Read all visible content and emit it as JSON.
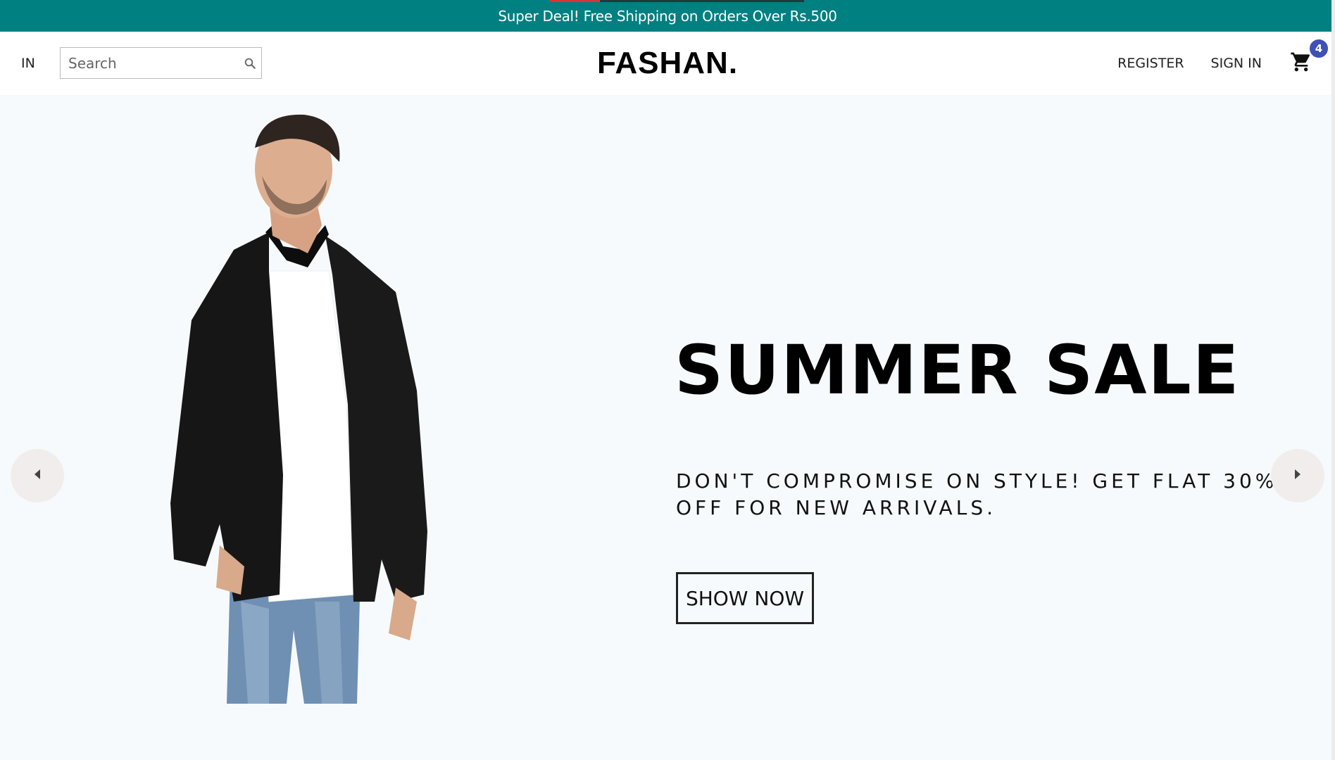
{
  "announcement": {
    "text": "Super Deal! Free Shipping on Orders Over Rs.500"
  },
  "navbar": {
    "language": "IN",
    "search": {
      "placeholder": "Search",
      "value": ""
    },
    "logo": "FASHAN.",
    "links": {
      "register": "REGISTER",
      "sign_in": "SIGN IN"
    },
    "cart": {
      "count": "4"
    }
  },
  "hero": {
    "title": "SUMMER SALE",
    "description": "DON'T COMPROMISE ON STYLE! GET FLAT 30% OFF FOR NEW ARRIVALS.",
    "cta": "SHOW NOW",
    "background": "#f6fafc"
  },
  "colors": {
    "announcement_bg": "#008080",
    "badge": "#3f51b5"
  },
  "icons": {
    "search": "search-icon",
    "cart": "cart-icon",
    "prev": "arrow-left-icon",
    "next": "arrow-right-icon"
  }
}
